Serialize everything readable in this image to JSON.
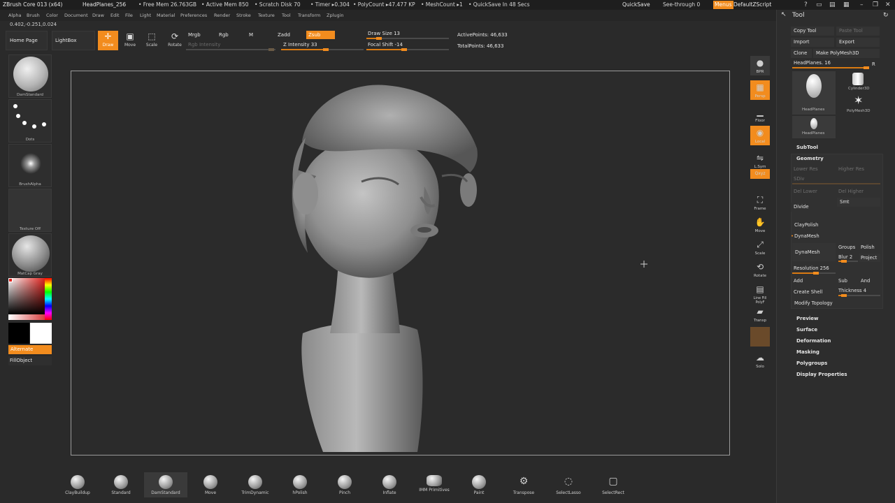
{
  "titlebar": {
    "app": "ZBrush Core 013 (x64)",
    "doc": "HeadPlanes_256",
    "free_mem": "• Free Mem 26.763GB",
    "active_mem": "• Active Mem 850",
    "scratch": "• Scratch Disk 70",
    "timer": "• Timer ▸0.304",
    "polycount": "• PolyCount ▸47.477 KP",
    "meshcount": "• MeshCount ▸1",
    "quicksave_in": "• QuickSave In 48 Secs",
    "quicksave": "QuickSave",
    "see_through": "See-through  0",
    "menus": "Menus",
    "script": "DefaultZScript"
  },
  "menubar": [
    "Alpha",
    "Brush",
    "Color",
    "Document",
    "Draw",
    "Edit",
    "File",
    "Light",
    "Material",
    "Preferences",
    "Render",
    "Stroke",
    "Texture",
    "Tool",
    "Transform",
    "Zplugin"
  ],
  "coords": "0.402,-0.251,0.024",
  "top": {
    "home": "Home Page",
    "lightbox": "LightBox",
    "draw": "Draw",
    "move": "Move",
    "scale": "Scale",
    "rotate": "Rotate",
    "mrgb": "Mrgb",
    "rgb": "Rgb",
    "m": "M",
    "rgb_intensity": "Rgb Intensity",
    "zadd": "Zadd",
    "zsub": "Zsub",
    "z_intensity": "Z Intensity 33",
    "draw_size": "Draw Size 13",
    "focal_shift": "Focal Shift -14",
    "active_points": "ActivePoints: 46,633",
    "total_points": "TotalPoints: 46,633"
  },
  "left": {
    "brush": "DamStandard",
    "stroke": "Dots",
    "alpha": "BrushAlpha",
    "texture": "Texture Off",
    "material": "MatCap Gray",
    "alternate": "Alternate",
    "fillobject": "FillObject"
  },
  "right_shelf": [
    "BPR",
    "Persp",
    "Floor",
    "Local",
    "L.Sym",
    "Qxyz",
    "Frame",
    "Move",
    "Scale",
    "Rotate",
    "Line Fill PolyF",
    "Transp",
    "Ghost",
    "Solo"
  ],
  "tool": {
    "title": "Tool",
    "copy_tool": "Copy Tool",
    "paste_tool": "Paste Tool",
    "import": "Import",
    "export": "Export",
    "clone": "Clone",
    "make_polymesh": "Make PolyMesh3D",
    "headplanes": "HeadPlanes. 16",
    "r": "R",
    "thumbs": [
      "HeadPlanes",
      "Cylinder3D",
      "PolyMesh3D",
      "HeadPlanes"
    ],
    "subtool": "SubTool",
    "geometry": "Geometry",
    "lower_res": "Lower Res",
    "higher_res": "Higher Res",
    "sdiv": "SDiv",
    "del_lower": "Del Lower",
    "del_higher": "Del Higher",
    "divide": "Divide",
    "smt": "Smt",
    "claypolish": "ClayPolish",
    "dynamesh_hdr": "DynaMesh",
    "dynamesh": "DynaMesh",
    "groups": "Groups",
    "polish": "Polish",
    "blur": "Blur 2",
    "project": "Project",
    "resolution": "Resolution 256",
    "add": "Add",
    "sub": "Sub",
    "and": "And",
    "create_shell": "Create Shell",
    "thickness": "Thickness 4",
    "modify_topology": "Modify Topology",
    "sections": [
      "Preview",
      "Surface",
      "Deformation",
      "Masking",
      "Polygroups",
      "Display Properties"
    ]
  },
  "bottom": [
    "ClayBuildup",
    "Standard",
    "DamStandard",
    "Move",
    "TrimDynamic",
    "hPolish",
    "Pinch",
    "Inflate",
    "IMM Primitives",
    "Paint",
    "Transpose",
    "SelectLasso",
    "SelectRect"
  ]
}
